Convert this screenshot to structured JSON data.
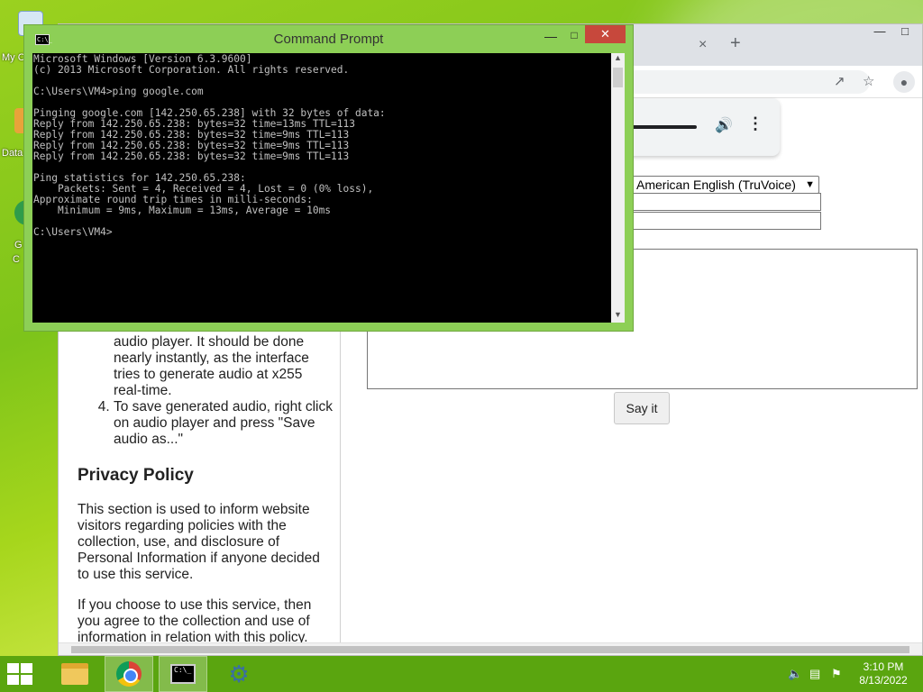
{
  "desktop": {
    "icons": [
      {
        "label": "My C"
      },
      {
        "label": "Data"
      },
      {
        "label": "G"
      },
      {
        "label": "C"
      }
    ]
  },
  "browser": {
    "tab_close": "×",
    "new_tab": "+",
    "audio_player": {
      "volume_icon": "volume-icon",
      "more_icon": "more-vert-icon"
    },
    "voice_select": {
      "value": "American English (TruVoice)"
    },
    "say_it_label": "Say it",
    "instructions": {
      "item3_text": "audio player. It should be done nearly instantly, as the interface tries to generate audio at x255 real-time.",
      "item4_text": "To save generated audio, right click on audio player and press \"Save audio as...\""
    },
    "privacy": {
      "heading": "Privacy Policy",
      "p1": "This section is used to inform website visitors regarding policies with the collection, use, and disclosure of Personal Information if anyone decided to use this service.",
      "p2": "If you choose to use this service, then you agree to the collection and use of information in relation with this policy."
    }
  },
  "cmd": {
    "title": "Command Prompt",
    "icon_text": "C:\\_",
    "output": "Microsoft Windows [Version 6.3.9600]\n(c) 2013 Microsoft Corporation. All rights reserved.\n\nC:\\Users\\VM4>ping google.com\n\nPinging google.com [142.250.65.238] with 32 bytes of data:\nReply from 142.250.65.238: bytes=32 time=13ms TTL=113\nReply from 142.250.65.238: bytes=32 time=9ms TTL=113\nReply from 142.250.65.238: bytes=32 time=9ms TTL=113\nReply from 142.250.65.238: bytes=32 time=9ms TTL=113\n\nPing statistics for 142.250.65.238:\n    Packets: Sent = 4, Received = 4, Lost = 0 (0% loss),\nApproximate round trip times in milli-seconds:\n    Minimum = 9ms, Maximum = 13ms, Average = 10ms\n\nC:\\Users\\VM4>"
  },
  "taskbar": {
    "apps": [
      "file-explorer",
      "chrome",
      "command-prompt",
      "settings"
    ],
    "clock_time": "3:10 PM",
    "clock_date": "8/13/2022"
  },
  "colors": {
    "taskbar": "#5aa50f",
    "cmd_frame": "#8dcf56",
    "close_button": "#c7483c"
  }
}
